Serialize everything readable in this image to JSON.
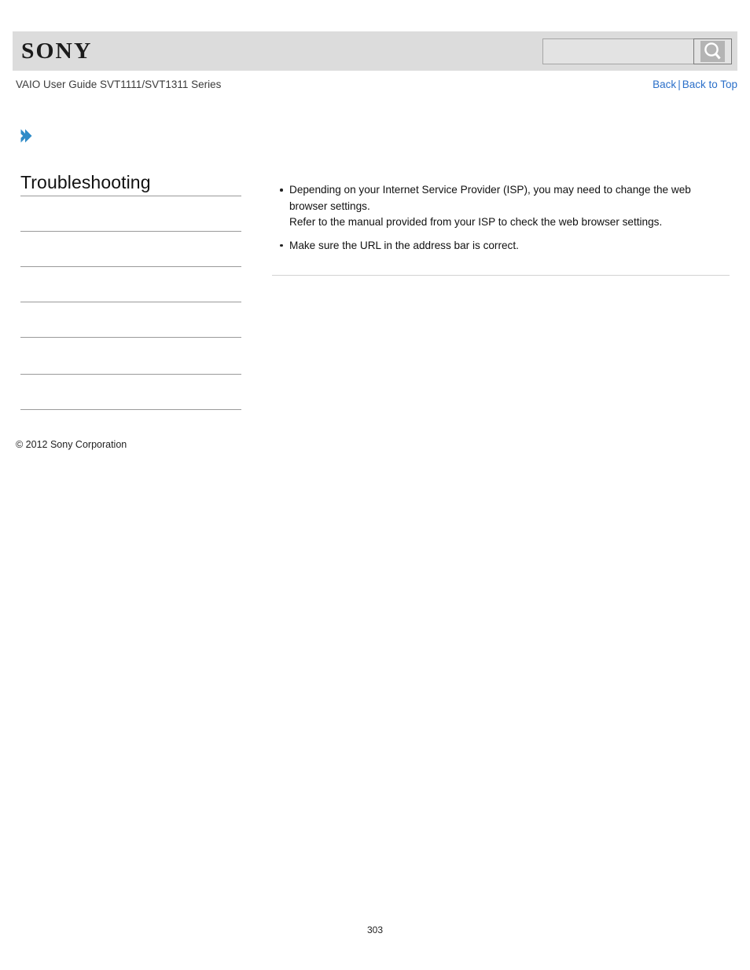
{
  "header": {
    "logo_text": "SONY",
    "logo_icon": "sony-wordmark",
    "search": {
      "value": "",
      "placeholder": "",
      "button_icon": "search-magnifier-icon"
    }
  },
  "title_row": {
    "guide_title": "VAIO User Guide SVT1111/SVT1311 Series",
    "back_label": "Back",
    "separator": "|",
    "back_to_top_label": "Back to Top"
  },
  "breadcrumb": {
    "arrow_icon": "blue-chevron-right-icon"
  },
  "sidebar": {
    "heading": "Troubleshooting",
    "items": [
      {
        "label": ""
      },
      {
        "label": ""
      },
      {
        "label": ""
      },
      {
        "label": ""
      },
      {
        "label": ""
      },
      {
        "label": ""
      }
    ]
  },
  "main": {
    "bullets": [
      {
        "lines": [
          "Depending on your Internet Service Provider (ISP), you may need to change the web browser settings.",
          "Refer to the manual provided from your ISP to check the web browser settings."
        ]
      },
      {
        "lines": [
          "Make sure the URL in the address bar is correct."
        ]
      }
    ]
  },
  "footer": {
    "copyright": "© 2012 Sony Corporation",
    "page_number": "303"
  },
  "colors": {
    "header_bar": "#dcdcdc",
    "link": "#2a6fc9",
    "arrow_blue": "#2e8bc8",
    "divider": "#9a9a9a",
    "content_rule": "#d2d2d2"
  }
}
